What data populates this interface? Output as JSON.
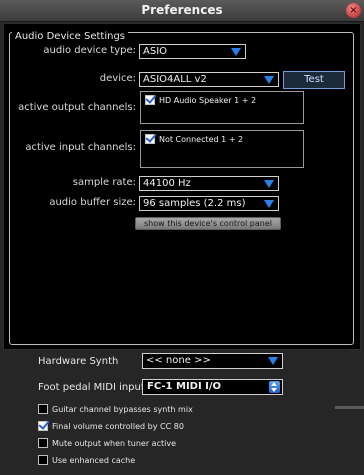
{
  "window": {
    "title": "Preferences"
  },
  "audio_settings": {
    "legend": "Audio Device Settings",
    "device_type": {
      "label": "audio device type:",
      "value": "ASIO"
    },
    "device": {
      "label": "device:",
      "value": "ASIO4ALL v2"
    },
    "test_button": "Test",
    "output_channels": {
      "label": "active output channels:",
      "items": [
        {
          "label": "HD Audio Speaker 1 + 2",
          "checked": true
        }
      ]
    },
    "input_channels": {
      "label": "active input channels:",
      "items": [
        {
          "label": "Not Connected 1 + 2",
          "checked": true
        }
      ]
    },
    "sample_rate": {
      "label": "sample rate:",
      "value": "44100 Hz"
    },
    "buffer_size": {
      "label": "audio buffer size:",
      "value": "96 samples (2.2 ms)"
    },
    "control_panel_button": "show this device's control panel"
  },
  "hardware_synth": {
    "label": "Hardware Synth",
    "value": "<< none >>"
  },
  "foot_pedal": {
    "label": "Foot pedal MIDI input:",
    "value": "FC-1 MIDI I/O"
  },
  "options": [
    {
      "label": "Guitar channel bypasses synth mix",
      "checked": false
    },
    {
      "label": "Final volume controlled by CC 80",
      "checked": true
    },
    {
      "label": "Mute output when tuner active",
      "checked": false
    },
    {
      "label": "Use enhanced cache",
      "checked": false
    }
  ],
  "colors": {
    "accent": "#2b7fe8",
    "background": "#262626",
    "panel": "#000000"
  }
}
